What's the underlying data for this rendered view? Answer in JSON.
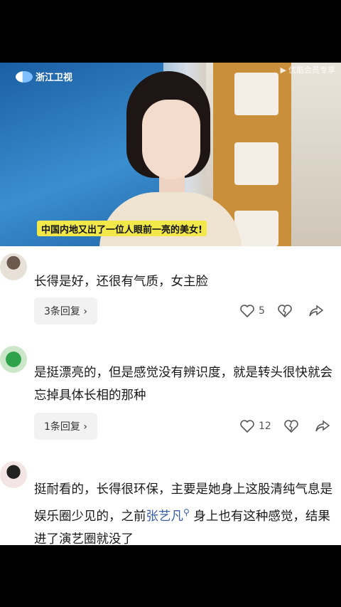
{
  "video": {
    "channel_logo": "浙江卫视",
    "watermark": "优酷会员专享",
    "caption": "中国内地又出了一位人眼前一亮的美女!"
  },
  "comments": [
    {
      "text": "长得是好，还很有气质，女主脸",
      "reply_label": "3条回复 ›",
      "likes": "5"
    },
    {
      "text": "是挺漂亮的，但是感觉没有辨识度，就是转头很快就会忘掉具体长相的那种",
      "reply_label": "1条回复 ›",
      "likes": "12"
    },
    {
      "text_before": "挺耐看的，长得很环保，主要是她身上这股清纯气息是娱乐圈少见的，之前",
      "link": "张艺凡",
      "text_after": " 身上也有这种感觉，结果进了演艺圈就没了"
    }
  ]
}
